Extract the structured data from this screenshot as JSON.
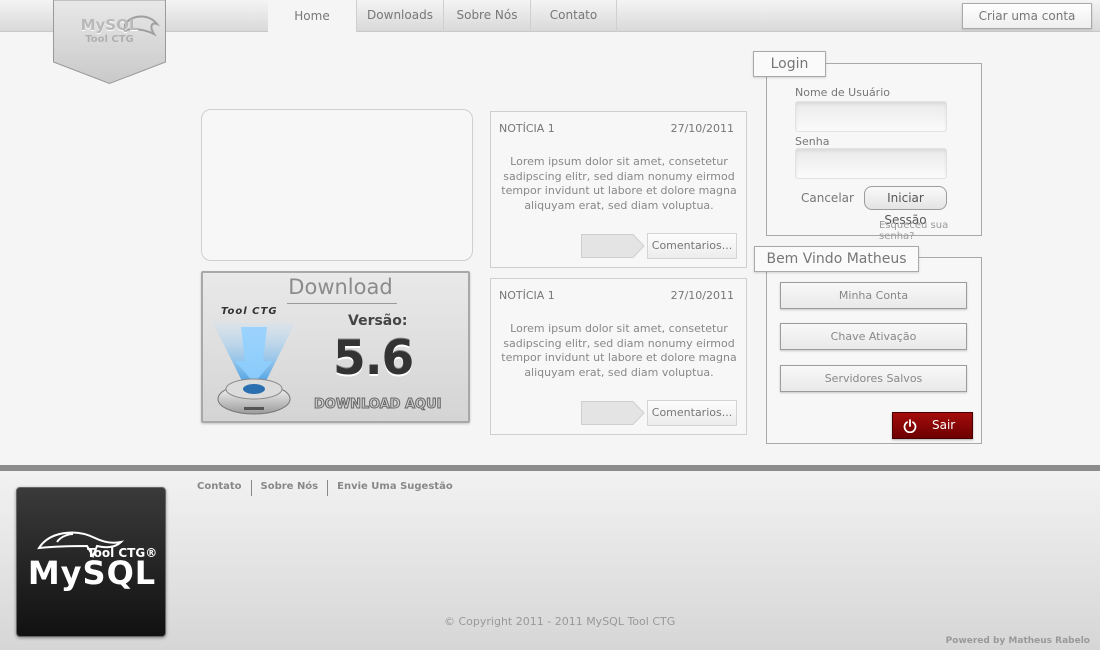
{
  "logo": {
    "title": "MySQL",
    "subtitle": "Tool CTG"
  },
  "nav": {
    "tabs": [
      {
        "label": "Home",
        "active": true
      },
      {
        "label": "Downloads"
      },
      {
        "label": "Sobre Nós"
      },
      {
        "label": "Contato"
      }
    ]
  },
  "header": {
    "create_account": "Criar uma conta"
  },
  "download": {
    "title": "Download",
    "brand": "Tool CTG",
    "version_label": "Versão:",
    "version": "5.6",
    "cta": "DOWNLOAD AQUI"
  },
  "news": [
    {
      "title": "NOTÍCIA 1",
      "date": "27/10/2011",
      "body": "Lorem ipsum dolor sit amet, consetetur sadipscing elitr, sed diam nonumy eirmod tempor invidunt ut labore et dolore magna aliquyam erat, sed diam voluptua.",
      "comments_label": "Comentarios..."
    },
    {
      "title": "NOTÍCIA 1",
      "date": "27/10/2011",
      "body": "Lorem ipsum dolor sit amet, consetetur sadipscing elitr, sed diam nonumy eirmod tempor invidunt ut labore et dolore magna aliquyam erat, sed diam voluptua.",
      "comments_label": "Comentarios..."
    }
  ],
  "login": {
    "tab": "Login",
    "username_label": "Nome de Usuário",
    "username_value": "",
    "password_label": "Senha",
    "password_value": "",
    "cancel": "Cancelar",
    "submit": "Iniciar Sessão",
    "forgot": "Esqueceu sua senha?"
  },
  "welcome": {
    "tab": "Bem Vindo Matheus",
    "buttons": [
      "Minha Conta",
      "Chave Ativação",
      "Servidores Salvos"
    ],
    "logout": "Sair",
    "logout_color": "#8b0000"
  },
  "footer": {
    "links": [
      "Contato",
      "Sobre Nós",
      "Envie Uma Sugestão"
    ],
    "logo_sub": "Tool CTG®",
    "logo_main": "MySQL",
    "copyright": "© Copyright 2011 - 2011 MySQL Tool CTG",
    "powered": "Powered by Matheus Rabelo"
  }
}
